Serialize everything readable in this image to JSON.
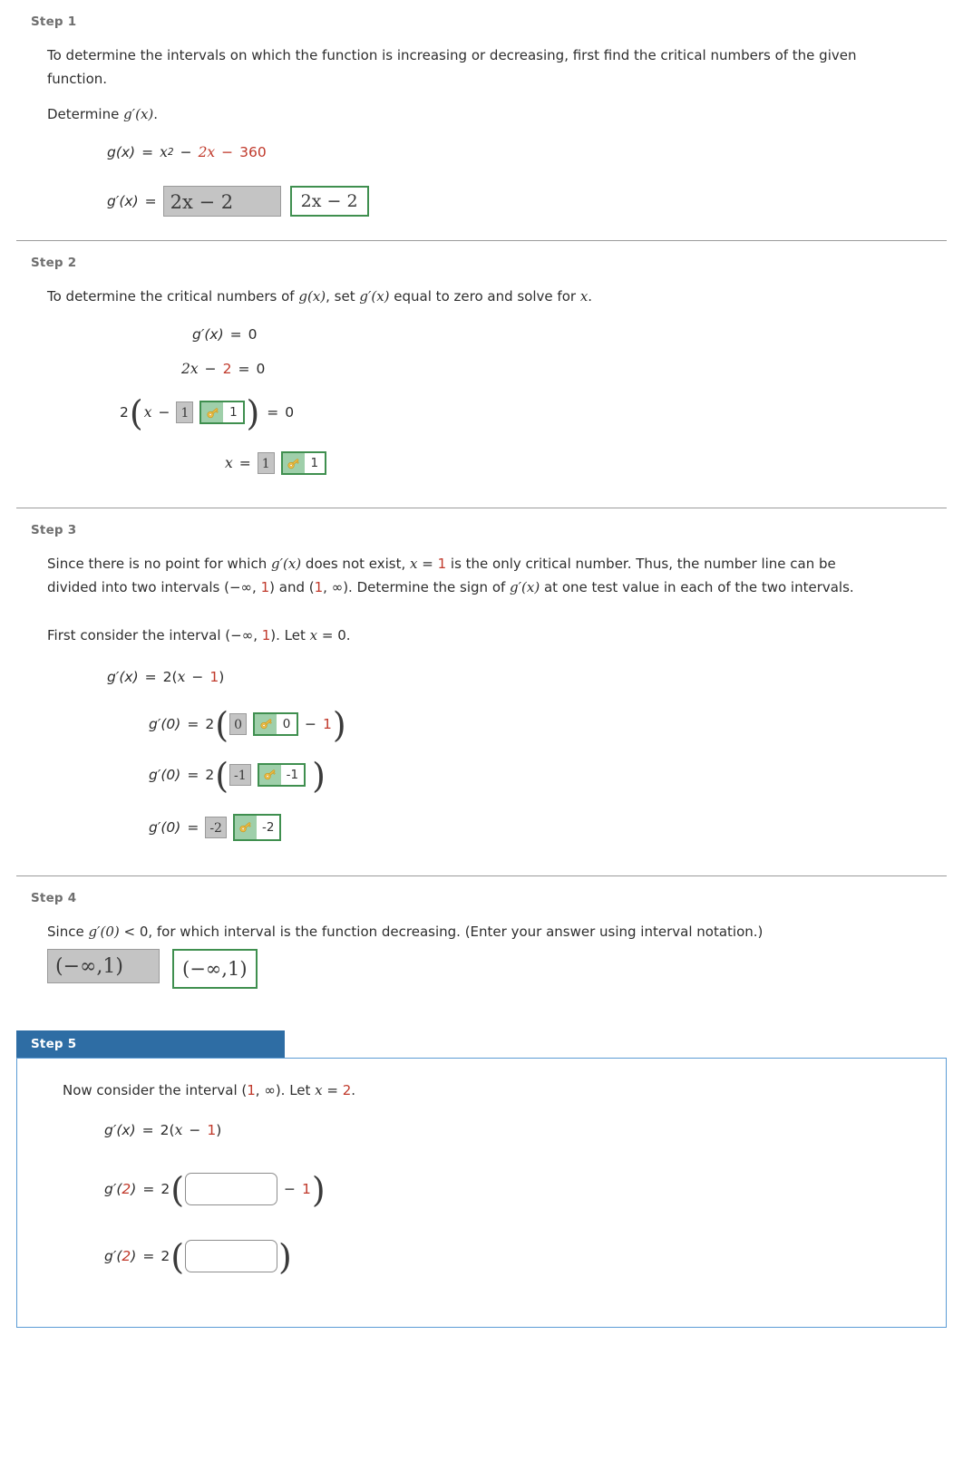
{
  "steps": [
    {
      "label": "Step 1",
      "paragraphs": [
        "To determine the intervals on which the function is increasing or decreasing, first find the critical numbers of the given function.",
        "Determine g′(x)."
      ],
      "determine_prefix": "Determine ",
      "determine_fn": "g′(x)",
      "determine_suffix": ".",
      "eq_gx_lhs": "g(x)",
      "eq_gx_eq": "=",
      "eq_gx_x": "x",
      "eq_gx_exp": "2",
      "eq_gx_minus1": "−",
      "eq_gx_term2": "2x",
      "eq_gx_minus2": "−",
      "eq_gx_term3": "360",
      "eq_gpx_lhs": "g′(x)",
      "eq_gpx_eq": "=",
      "answer_filled": "2x − 2",
      "answer_correct": "2x − 2"
    },
    {
      "label": "Step 2",
      "paragraph_a": "To determine the critical numbers of ",
      "paragraph_fn1": "g(x)",
      "paragraph_b": ", set ",
      "paragraph_fn2": "g′(x)",
      "paragraph_c": " equal to zero and solve for ",
      "paragraph_var": "x",
      "paragraph_d": ".",
      "eq1_lhs": "g′(x)",
      "eq1_eq": "=",
      "eq1_rhs": "0",
      "eq2_a": "2x",
      "eq2_minus": "−",
      "eq2_b": "2",
      "eq2_eq": "=",
      "eq2_rhs": "0",
      "eq3_coef": "2",
      "eq3_var": "x",
      "eq3_minus": "−",
      "eq3_filled": "1",
      "eq3_correct": "1",
      "eq3_eq": "=",
      "eq3_rhs": "0",
      "eq4_var": "x",
      "eq4_eq": "=",
      "eq4_filled": "1",
      "eq4_correct": "1"
    },
    {
      "label": "Step 3",
      "p1_a": "Since there is no point for which ",
      "p1_fn": "g′(x)",
      "p1_b": " does not exist, ",
      "p1_var": "x",
      "p1_eq": " = ",
      "p1_val": "1",
      "p1_c": " is the only critical number. Thus, the number line can be divided into two intervals (−∞, ",
      "p1_val2": "1",
      "p1_d": ") and (",
      "p1_val3": "1",
      "p1_e": ", ∞). Determine the sign of ",
      "p1_fn2": "g′(x)",
      "p1_f": " at one test value in each of the two intervals.",
      "p2_a": "First consider the interval (−∞, ",
      "p2_val": "1",
      "p2_b": "). Let ",
      "p2_var": "x",
      "p2_c": " = 0.",
      "eq1_lhs": "g′(x)",
      "eq1_eq": "=",
      "eq1_coef": "2(",
      "eq1_var": "x",
      "eq1_minus": "−",
      "eq1_val": "1",
      "eq1_close": ")",
      "eq2_lhs": "g′(0)",
      "eq2_eq": "=",
      "eq2_coef": "2",
      "eq2_filled": "0",
      "eq2_correct": "0",
      "eq2_minus": "−",
      "eq2_val": "1",
      "eq3_lhs": "g′(0)",
      "eq3_eq": "=",
      "eq3_coef": "2",
      "eq3_filled": "-1",
      "eq3_correct": "-1",
      "eq4_lhs": "g′(0)",
      "eq4_eq": "=",
      "eq4_filled": "-2",
      "eq4_correct": "-2"
    },
    {
      "label": "Step 4",
      "p1_a": "Since ",
      "p1_fn": "g′(0)",
      "p1_b": " < 0, for which interval is the function decreasing. (Enter your answer using interval notation.)",
      "answer_filled": "(−∞,1)",
      "answer_correct": "(−∞,1)"
    }
  ],
  "active_step": {
    "label": "Step 5",
    "p1_a": "Now consider the interval (",
    "p1_val": "1",
    "p1_b": ", ∞). Let ",
    "p1_var": "x",
    "p1_c": " = ",
    "p1_val2": "2",
    "p1_d": ".",
    "eq1_lhs": "g′(x)",
    "eq1_eq": "=",
    "eq1_coef": "2(",
    "eq1_var": "x",
    "eq1_minus": "−",
    "eq1_val": "1",
    "eq1_close": ")",
    "eq2_lhs_a": "g′(",
    "eq2_lhs_val": "2",
    "eq2_lhs_b": ")",
    "eq2_eq": "=",
    "eq2_coef": "2",
    "eq2_minus": "−",
    "eq2_val": "1",
    "eq3_lhs_a": "g′(",
    "eq3_lhs_val": "2",
    "eq3_lhs_b": ")",
    "eq3_eq": "=",
    "eq3_coef": "2",
    "input_placeholder": ""
  },
  "colors": {
    "red_accent": "#c0392b",
    "green_border": "#3f8f4f",
    "green_fill": "#9fcfaa",
    "gray_fill": "#c4c4c4",
    "active_header_blue": "#2e6da4",
    "active_panel_border": "#5b9bd5"
  },
  "icons": {
    "key": "key-icon"
  }
}
